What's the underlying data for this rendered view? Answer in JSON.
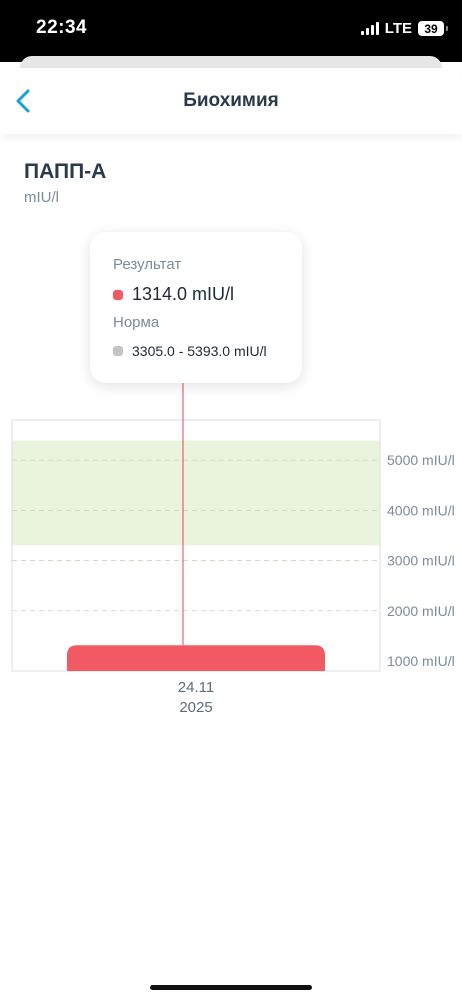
{
  "status": {
    "time": "22:34",
    "network": "LTE",
    "battery": "39"
  },
  "header": {
    "title": "Биохимия"
  },
  "metric": {
    "name": "ПАПП-А",
    "unit": "mIU/l"
  },
  "tooltip": {
    "result_label": "Результат",
    "result_value": "1314.0 mIU/l",
    "norm_label": "Норма",
    "norm_value": "3305.0 - 5393.0 mIU/l"
  },
  "colors": {
    "result": "#f25a63",
    "norm_band": "#eaf4dd",
    "norm_dot": "#c4c4c4",
    "accent": "#1aa0d8"
  },
  "chart_data": {
    "type": "bar",
    "categories": [
      "24.11\n2025"
    ],
    "category_lines": [
      [
        "24.11",
        "2025"
      ]
    ],
    "values": [
      1314.0
    ],
    "norm_range": [
      3305.0,
      5393.0
    ],
    "ylim": [
      800,
      5800
    ],
    "y_ticks": [
      1000,
      2000,
      3000,
      4000,
      5000
    ],
    "y_tick_labels": [
      "1000 mIU/l",
      "2000 mIU/l",
      "3000 mIU/l",
      "4000 mIU/l",
      "5000 mIU/l"
    ],
    "grid": "dashed",
    "y_axis_side": "right"
  }
}
